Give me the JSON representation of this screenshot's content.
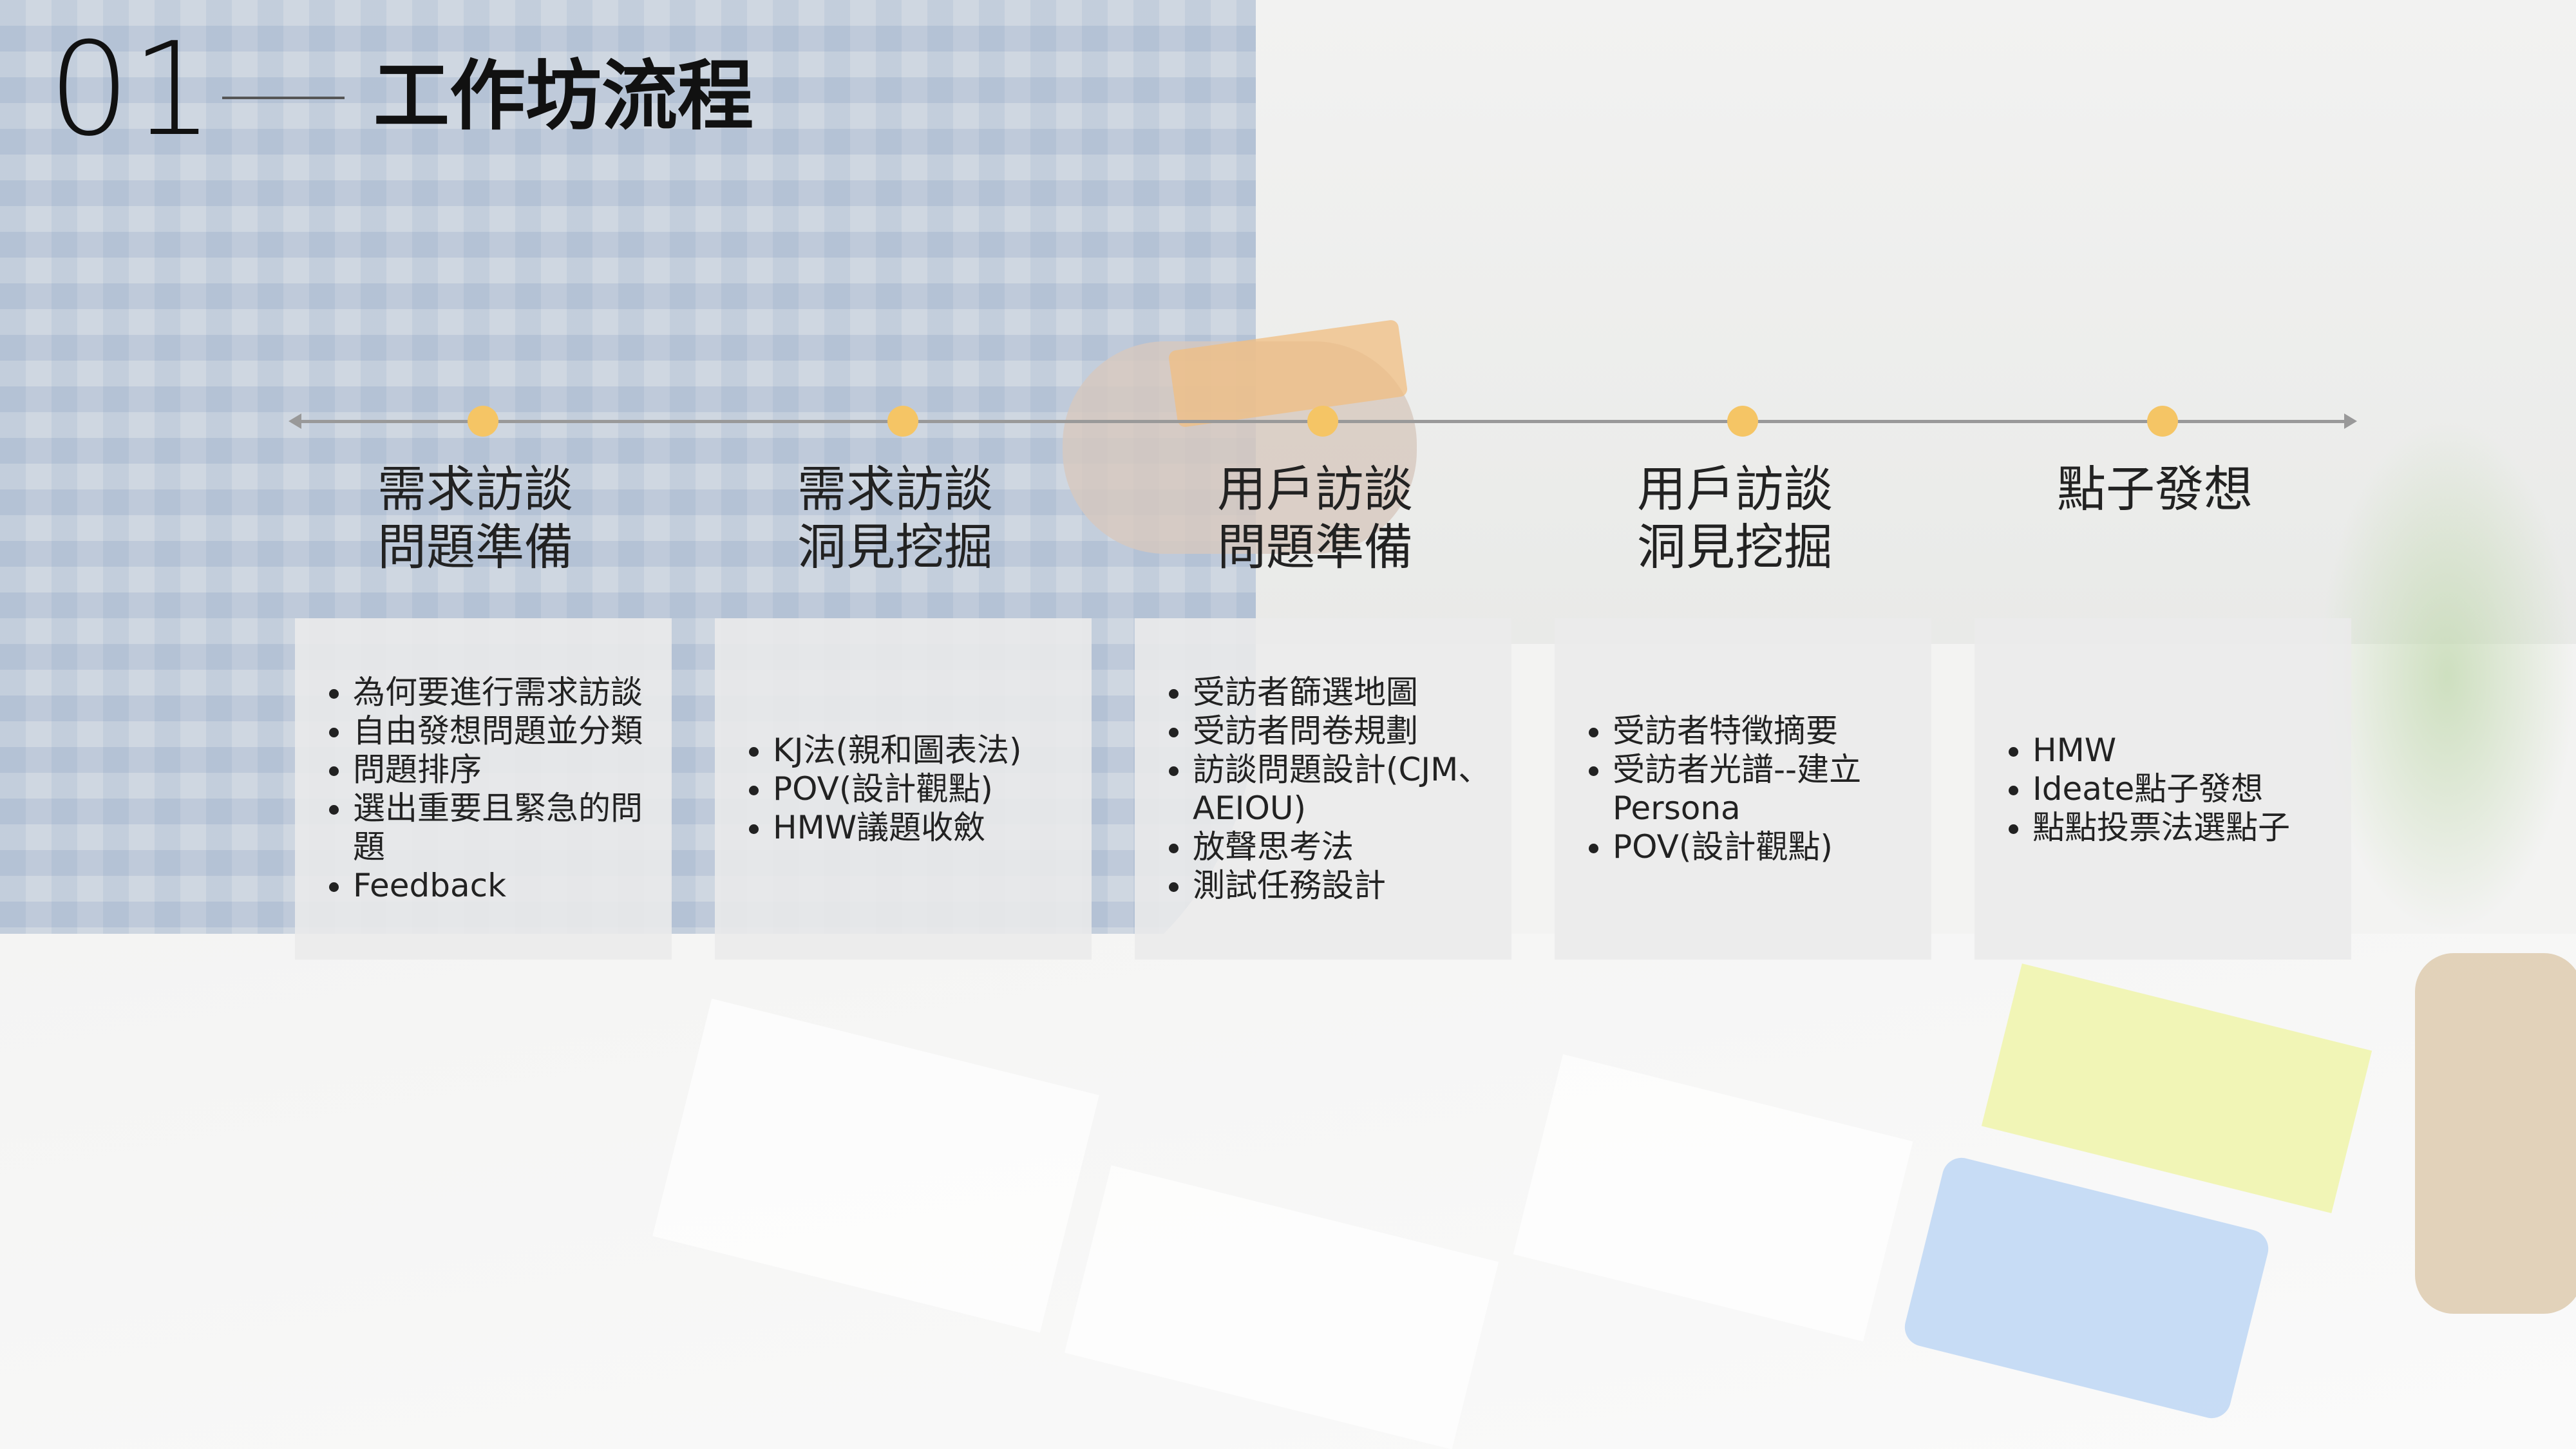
{
  "header": {
    "section_number": "01",
    "title": "工作坊流程"
  },
  "colors": {
    "dot": "#f5c565",
    "card_bg": "#ebebeb",
    "timeline": "#999999",
    "text": "#222222"
  },
  "stages": [
    {
      "title_line1": "需求訪談",
      "title_line2": "問題準備",
      "items": [
        "為何要進行需求訪談",
        "自由發想問題並分類",
        "問題排序",
        "選出重要且緊急的問題",
        "Feedback"
      ]
    },
    {
      "title_line1": "需求訪談",
      "title_line2": "洞見挖掘",
      "items": [
        "KJ法(親和圖表法)",
        "POV(設計觀點)",
        "HMW議題收斂"
      ]
    },
    {
      "title_line1": "用戶訪談",
      "title_line2": "問題準備",
      "items": [
        "受訪者篩選地圖",
        "受訪者問卷規劃",
        "訪談問題設計(CJM、AEIOU)",
        "放聲思考法",
        "測試任務設計"
      ]
    },
    {
      "title_line1": "用戶訪談",
      "title_line2": "洞見挖掘",
      "items": [
        "受訪者特徵摘要",
        "受訪者光譜--建立Persona",
        "POV(設計觀點)"
      ]
    },
    {
      "title_line1": "點子發想",
      "title_line2": "",
      "items": [
        "HMW",
        "Ideate點子發想",
        "點點投票法選點子"
      ]
    }
  ]
}
